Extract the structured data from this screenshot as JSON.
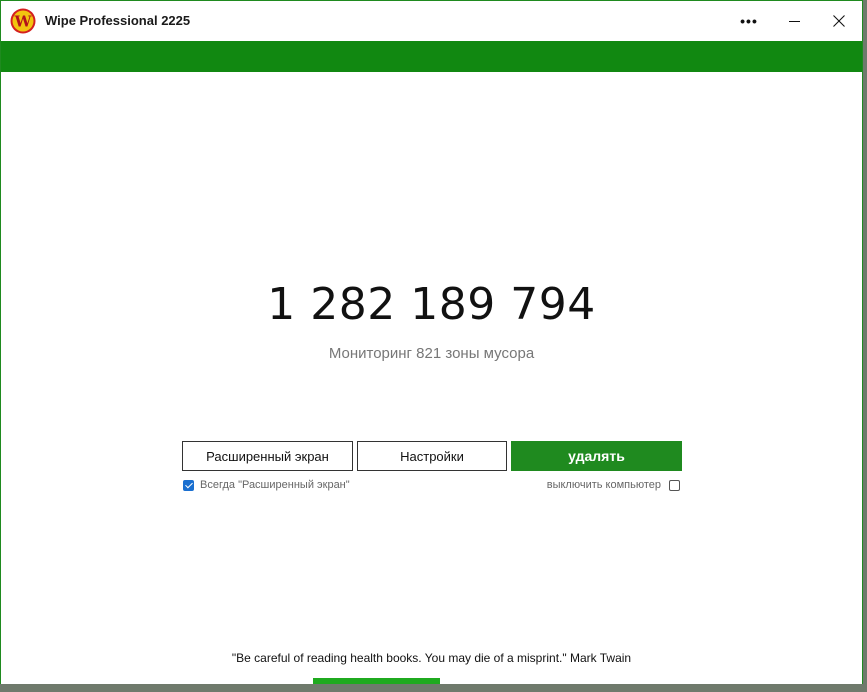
{
  "window": {
    "title": "Wipe Professional 2225",
    "logo_letter": "W"
  },
  "titlebar": {
    "more_label": "•••",
    "minimize_label": "—",
    "close_label": "✕"
  },
  "main": {
    "counter": "1 282 189 794",
    "subtitle": "Мониторинг 821 зоны мусора"
  },
  "buttons": {
    "extended_screen": "Расширенный экран",
    "settings": "Настройки",
    "delete": "удалять"
  },
  "options": {
    "always_extended": {
      "label": "Всегда \"Расширенный экран\"",
      "checked": true
    },
    "shutdown": {
      "label": "выключить компьютер",
      "checked": false
    }
  },
  "footer": {
    "quote": "\"Be careful of reading health books. You may die of a misprint.\" Mark Twain"
  },
  "colors": {
    "accent_green": "#1f8a1f",
    "checkbox_blue": "#1a6fd0"
  }
}
